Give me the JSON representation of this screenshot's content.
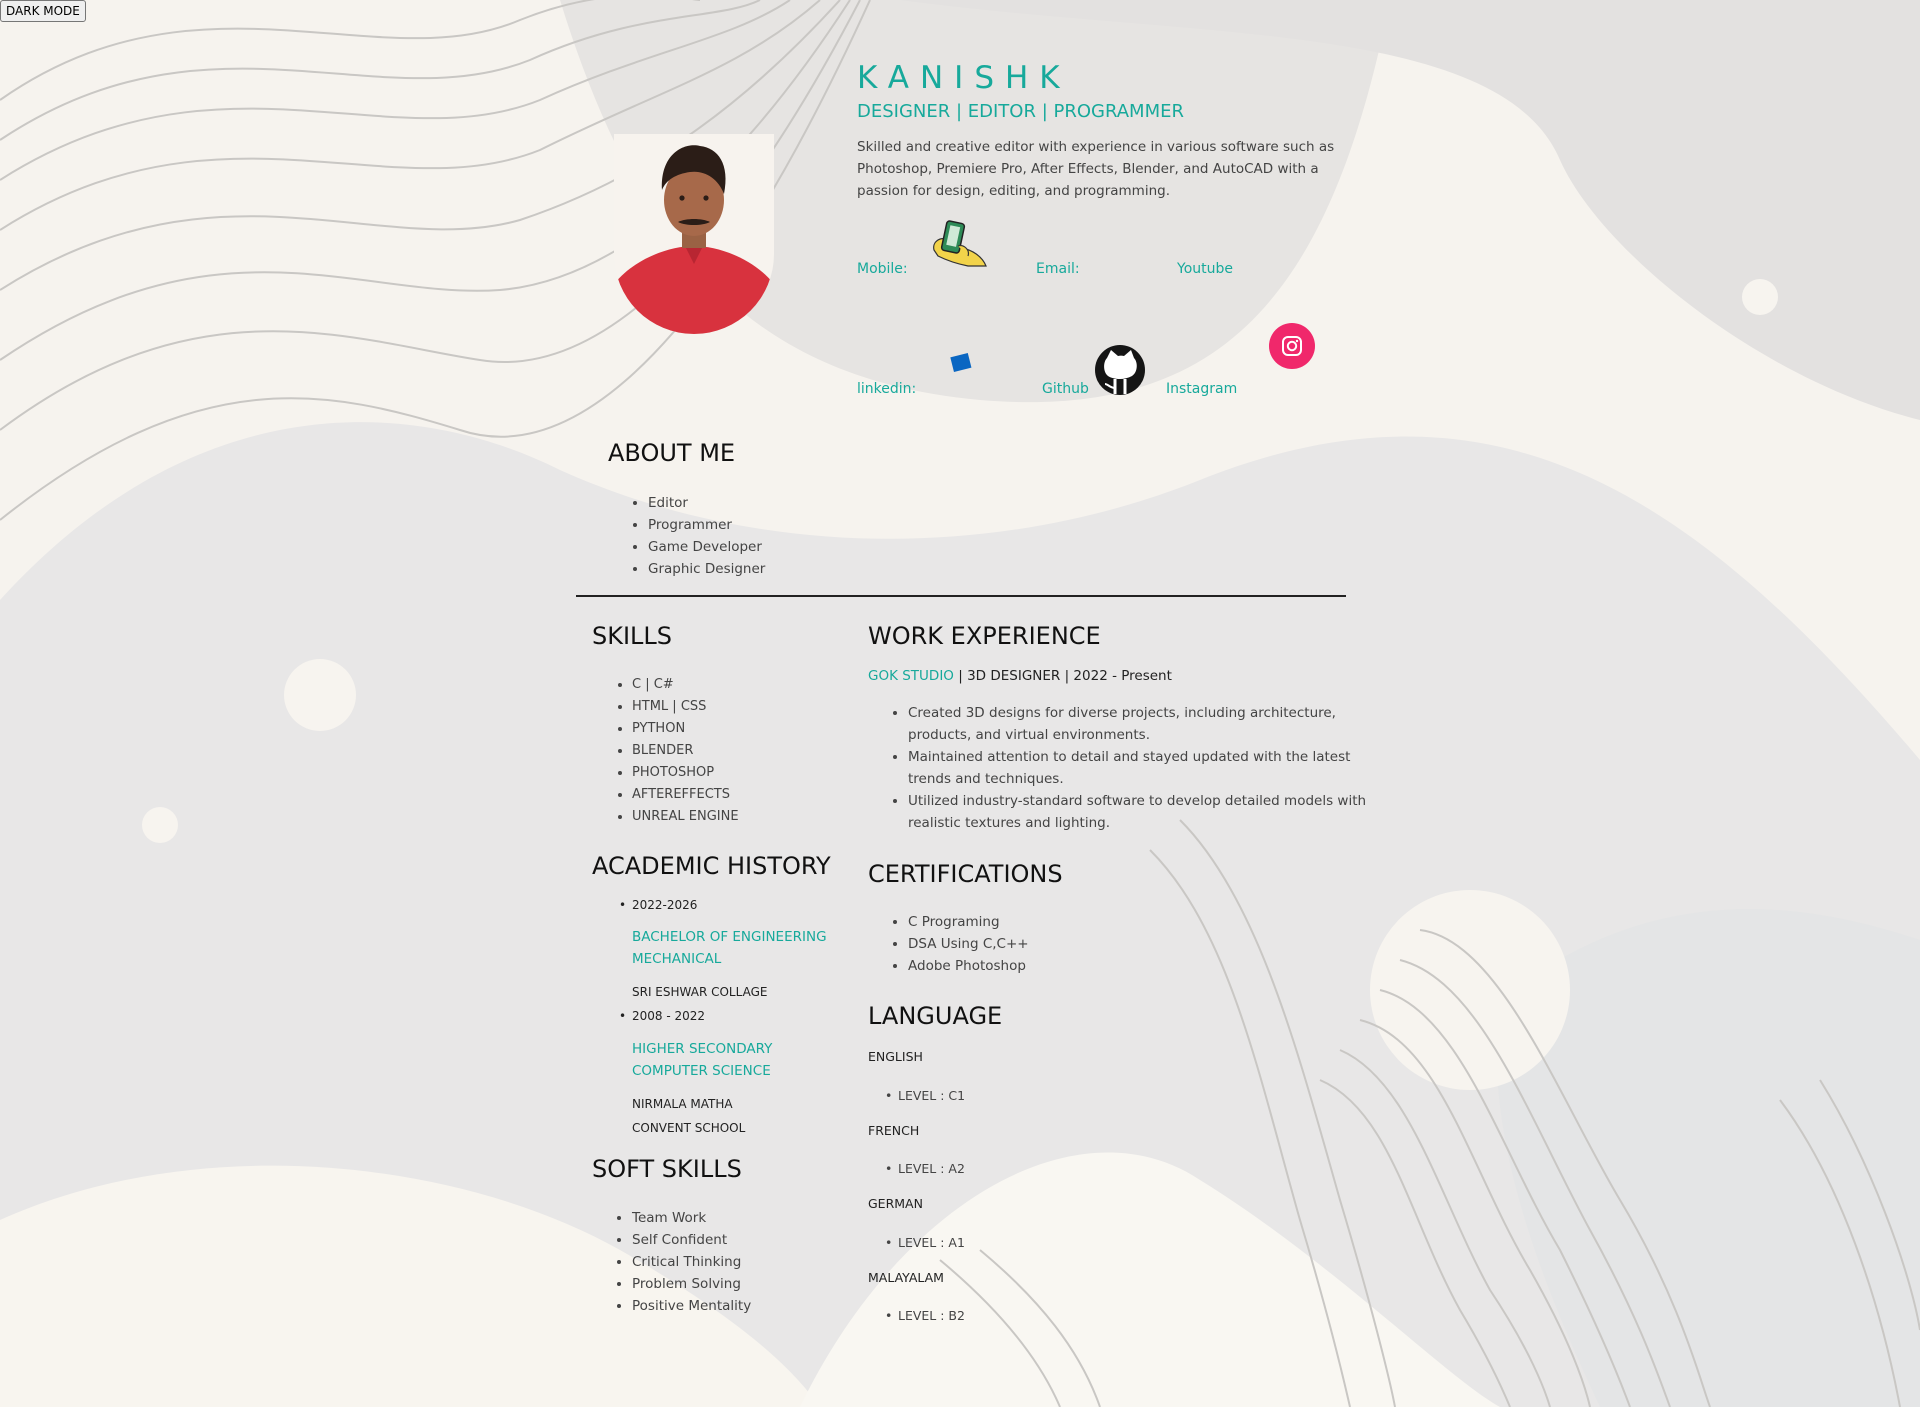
{
  "toolbar": {
    "dark_mode_label": "DARK MODE"
  },
  "header": {
    "name": "KANISHK",
    "role": "DESIGNER | EDITOR | PROGRAMMER",
    "bio": "Skilled and creative editor with experience in various software such as Photoshop, Premiere Pro, After Effects, Blender, and AutoCAD with a passion for design, editing, and programming."
  },
  "contacts": {
    "mobile": "Mobile:",
    "email": "Email:",
    "youtube": "Youtube",
    "linkedin": "linkedin:",
    "github": "Github",
    "instagram": "Instagram"
  },
  "about": {
    "title": "ABOUT ME",
    "items": [
      "Editor",
      "Programmer",
      "Game Developer",
      "Graphic Designer"
    ]
  },
  "skills": {
    "title": "SKILLS",
    "items": [
      "C | C#",
      "HTML | CSS",
      "PYTHON",
      "BLENDER",
      "PHOTOSHOP",
      "AFTEREFFECTS",
      "UNREAL ENGINE"
    ]
  },
  "academic": {
    "title": "ACADEMIC HISTORY",
    "entries": [
      {
        "years": "2022-2026",
        "degree_line1": "BACHELOR OF ENGINEERING",
        "degree_line2": "MECHANICAL",
        "school_line1": "SRI ESHWAR COLLAGE"
      },
      {
        "years": "2008 - 2022",
        "degree_line1": "HIGHER SECONDARY",
        "degree_line2": "COMPUTER SCIENCE",
        "school_line1": "NIRMALA MATHA",
        "school_line2": "CONVENT SCHOOL"
      }
    ]
  },
  "soft_skills": {
    "title": "SOFT SKILLS",
    "items": [
      "Team Work",
      "Self Confident",
      "Critical Thinking",
      "Problem Solving",
      "Positive Mentality"
    ]
  },
  "work": {
    "title": "WORK EXPERIENCE",
    "company": "GOK STUDIO",
    "detail": " | 3D DESIGNER | 2022 - Present",
    "items": [
      "Created 3D designs for diverse projects, including architecture, products, and virtual environments.",
      "Maintained attention to detail and stayed updated with the latest trends and techniques.",
      "Utilized industry-standard software to develop detailed models with realistic textures and lighting."
    ]
  },
  "certifications": {
    "title": "CERTIFICATIONS",
    "items": [
      "C Programing",
      "DSA Using C,C++",
      "Adobe Photoshop"
    ]
  },
  "languages": {
    "title": "LANGUAGE",
    "items": [
      {
        "name": "ENGLISH",
        "level": "LEVEL : C1"
      },
      {
        "name": "FRENCH",
        "level": "LEVEL : A2"
      },
      {
        "name": "GERMAN",
        "level": "LEVEL : A1"
      },
      {
        "name": "MALAYALAM",
        "level": "LEVEL : B2"
      }
    ]
  },
  "colors": {
    "accent": "#17a99b",
    "instagram": "#f0286b",
    "linkedin": "#0a66c2"
  },
  "icons": [
    "mobile-hand-icon",
    "linkedin-icon",
    "github-icon",
    "instagram-icon"
  ]
}
